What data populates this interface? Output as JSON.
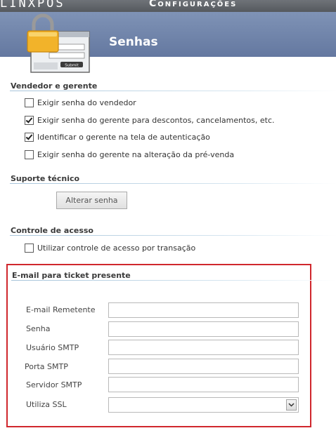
{
  "window": {
    "brand": "LINXPOS",
    "app_title": "Configurações",
    "page_title": "Senhas"
  },
  "sections": {
    "vendedor": {
      "title": "Vendedor e gerente",
      "items": [
        {
          "label": "Exigir senha do vendedor",
          "checked": false
        },
        {
          "label": "Exigir senha do gerente para descontos, cancelamentos, etc.",
          "checked": true
        },
        {
          "label": "Identificar o gerente na tela de autenticação",
          "checked": true
        },
        {
          "label": "Exigir senha do gerente na alteração da pré-venda",
          "checked": false
        }
      ]
    },
    "suporte": {
      "title": "Suporte técnico",
      "button_label": "Alterar senha"
    },
    "controle": {
      "title": "Controle de acesso",
      "items": [
        {
          "label": "Utilizar controle de acesso por transação",
          "checked": false
        }
      ]
    },
    "email": {
      "title": "E-mail para ticket presente",
      "fields": [
        {
          "label": "E-mail Remetente",
          "value": ""
        },
        {
          "label": "Senha",
          "value": ""
        },
        {
          "label": "Usuário SMTP",
          "value": ""
        },
        {
          "label": "Porta SMTP",
          "value": ""
        },
        {
          "label": "Servidor SMTP",
          "value": ""
        },
        {
          "label": "Utiliza SSL",
          "value": ""
        }
      ]
    }
  },
  "colors": {
    "banner": "#7f93b6",
    "highlight": "#d0272d",
    "section_line": "#a7c4da"
  }
}
